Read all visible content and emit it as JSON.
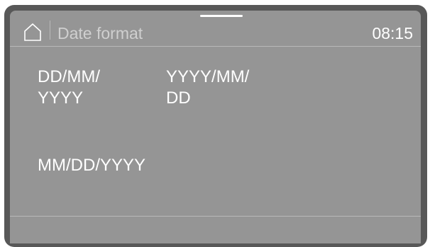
{
  "header": {
    "title": "Date format",
    "time": "08:15"
  },
  "options": [
    {
      "label_line1": "DD/MM/",
      "label_line2": "YYYY"
    },
    {
      "label_line1": "YYYY/MM/",
      "label_line2": "DD"
    },
    {
      "label_line1": "MM/DD/YYYY"
    }
  ],
  "icons": {
    "home": "home-icon"
  },
  "colors": {
    "bezel": "#585858",
    "screen": "#959595",
    "text": "#ffffff",
    "divider": "#b9b9b9"
  }
}
